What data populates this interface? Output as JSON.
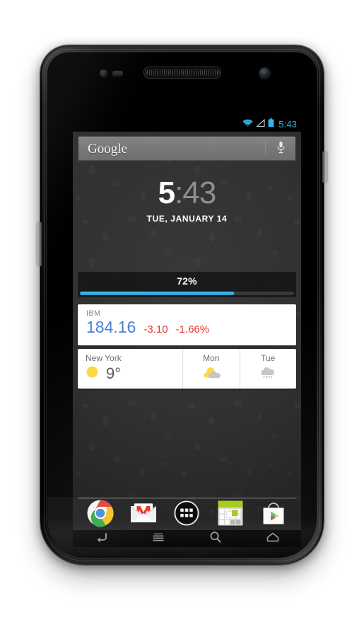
{
  "device": {
    "name": "android-smartphone",
    "hardware": {
      "proximity_sensor": "proximity-sensor",
      "light_sensor": "light-sensor",
      "earpiece": "earpiece-speaker",
      "front_camera": "front-camera",
      "volume_rocker": "volume-rocker-button",
      "power_button": "power-button"
    }
  },
  "status_bar": {
    "clock": "5:43",
    "accent_color": "#33b5e5",
    "icons": [
      {
        "name": "wifi-icon",
        "label": "wifi-full"
      },
      {
        "name": "signal-icon",
        "label": "cellular-signal-empty"
      },
      {
        "name": "battery-icon",
        "label": "battery-full"
      }
    ]
  },
  "search": {
    "logo": "Google",
    "placeholder": "Google",
    "voice_icon": "microphone-icon"
  },
  "clock_widget": {
    "hour": "5",
    "minute": ":43",
    "date": "TUE, JANUARY 14"
  },
  "progress_widget": {
    "label": "72%",
    "percent": 72,
    "fill_color": "#33b5e5"
  },
  "stock_widget": {
    "symbol": "IBM",
    "price": "184.16",
    "change": "-3.10",
    "change_percent": "-1.66%",
    "price_color": "#4a7fd4",
    "change_color": "#e03b2f"
  },
  "weather_widget": {
    "city": "New York",
    "temperature": "9°",
    "current_icon": "sun-icon",
    "forecast": [
      {
        "day": "Mon",
        "icon": "sun-behind-cloud-icon"
      },
      {
        "day": "Tue",
        "icon": "rain-cloud-icon"
      }
    ]
  },
  "dock": {
    "items": [
      {
        "name": "dock-item-chrome",
        "label": "Chrome",
        "icon": "chrome-icon"
      },
      {
        "name": "dock-item-gmail",
        "label": "Gmail",
        "icon": "gmail-icon"
      },
      {
        "name": "dock-item-app-drawer",
        "label": "Apps",
        "icon": "app-drawer-icon"
      },
      {
        "name": "dock-item-calendar",
        "label": "Calendar",
        "icon": "calendar-icon"
      },
      {
        "name": "dock-item-play-store",
        "label": "Play Store",
        "icon": "play-store-icon"
      }
    ]
  },
  "nav_bar": {
    "buttons": [
      {
        "name": "nav-back-button",
        "label": "Back",
        "icon": "back-arrow-icon"
      },
      {
        "name": "nav-menu-button",
        "label": "Menu",
        "icon": "menu-lines-icon"
      },
      {
        "name": "nav-search-button",
        "label": "Search",
        "icon": "search-magnifier-icon"
      },
      {
        "name": "nav-home-button",
        "label": "Home",
        "icon": "home-icon"
      }
    ]
  }
}
